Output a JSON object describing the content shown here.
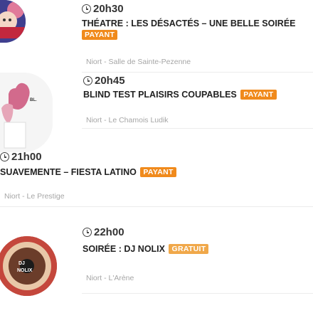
{
  "colors": {
    "payant": "#f08a1c",
    "gratuit": "#f0a84a",
    "location": "#a6a6a6",
    "separator": "#ececec"
  },
  "events": [
    {
      "time": "20h30",
      "title": "THÉATRE : LES DÉSACTÉS – UNE BELLE SOIRÉE",
      "badge": "PAYANT",
      "location": "Niort - Salle de Sainte-Pezenne",
      "image": "event-poster-theatre"
    },
    {
      "time": "20h45",
      "title": "BLIND TEST PLAISIRS COUPABLES",
      "badge": "PAYANT",
      "location": "Niort - Le Chamois Ludik",
      "image": "event-poster-blind-test"
    },
    {
      "time": "21h00",
      "title": "SUAVEMENTE – FIESTA LATINO",
      "badge": "PAYANT",
      "location": "Niort - Le Prestige",
      "image": "none"
    },
    {
      "time": "22h00",
      "title": "SOIRÉE : DJ NOLIX",
      "badge": "GRATUIT",
      "location": "Niort - L'Arène",
      "image": "event-poster-dj-nolix"
    }
  ]
}
